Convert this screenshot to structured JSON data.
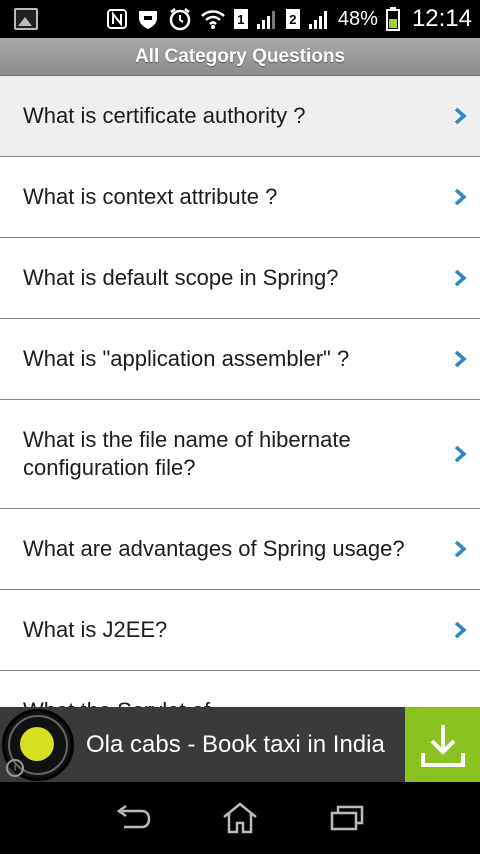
{
  "status_bar": {
    "battery_percent": "48%",
    "time": "12:14",
    "sim1_label": "1",
    "sim2_label": "2",
    "icons": [
      "gallery-icon",
      "nfc-icon",
      "shield-icon",
      "alarm-icon",
      "wifi-icon",
      "signal-icon",
      "signal-icon",
      "battery-icon"
    ]
  },
  "header": {
    "title": "All Category Questions"
  },
  "questions": [
    "What is certificate authority ?",
    "What is context attribute ?",
    "What is default scope in Spring?",
    "What is \"application assembler\" ?",
    "What is the file name of hibernate configuration file?",
    "What are advantages of Spring usage?",
    "What is J2EE?",
    "What the Servlet of"
  ],
  "ad": {
    "text": "Ola cabs - Book taxi in India",
    "info_symbol": "i",
    "accent_color": "#8bc21f",
    "logo_color": "#d4e020"
  },
  "colors": {
    "chevron": "#2f86c4",
    "title_bar": "#9a9a9a"
  }
}
